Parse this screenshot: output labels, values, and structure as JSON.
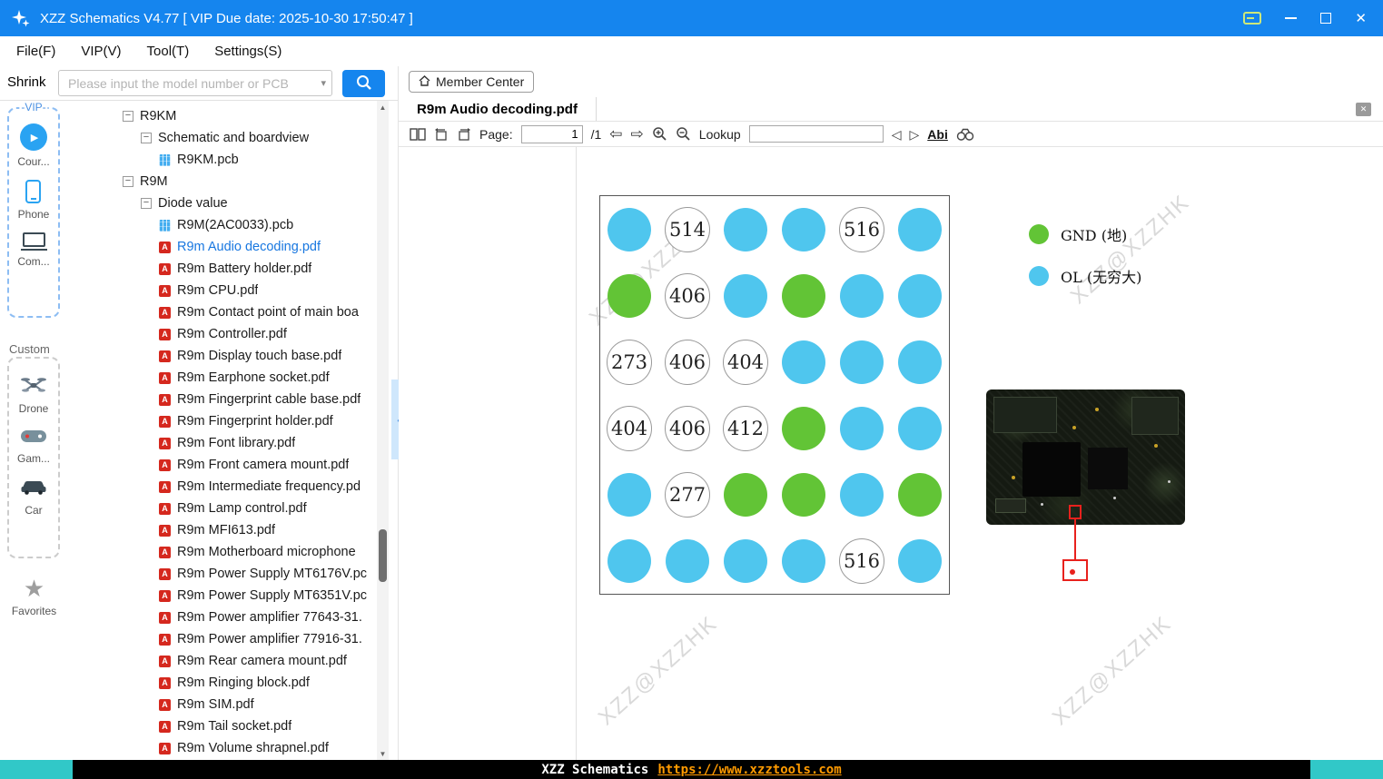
{
  "window": {
    "title": "XZZ Schematics V4.77 [ VIP Due date: 2025-10-30 17:50:47 ]"
  },
  "menubar": {
    "items": [
      "File(F)",
      "VIP(V)",
      "Tool(T)",
      "Settings(S)"
    ]
  },
  "searchbar": {
    "shrink_label": "Shrink",
    "placeholder": "Please input the model number or PCB"
  },
  "sidebar": {
    "vip_title": "-VIP-",
    "vip_items": [
      {
        "icon": "play-icon",
        "label": "Cour..."
      },
      {
        "icon": "phone-icon",
        "label": "Phone"
      },
      {
        "icon": "computer-icon",
        "label": "Com..."
      }
    ],
    "custom_title": "Custom",
    "custom_items": [
      {
        "icon": "drone-icon",
        "label": "Drone"
      },
      {
        "icon": "gamepad-icon",
        "label": "Gam..."
      },
      {
        "icon": "car-icon",
        "label": "Car"
      }
    ],
    "favorites": {
      "icon": "star-icon",
      "label": "Favorites"
    }
  },
  "tree": {
    "nodes": [
      {
        "label": "R9KM",
        "level": 0,
        "type": "folder"
      },
      {
        "label": "Schematic and boardview",
        "level": 1,
        "type": "folder"
      },
      {
        "label": "R9KM.pcb",
        "level": 2,
        "type": "pcb"
      },
      {
        "label": "R9M",
        "level": 0,
        "type": "folder"
      },
      {
        "label": "Diode value",
        "level": 1,
        "type": "folder"
      },
      {
        "label": "R9M(2AC0033).pcb",
        "level": 2,
        "type": "pcb"
      },
      {
        "label": "R9m Audio decoding.pdf",
        "level": 2,
        "type": "pdf",
        "selected": true
      },
      {
        "label": "R9m Battery holder.pdf",
        "level": 2,
        "type": "pdf"
      },
      {
        "label": "R9m CPU.pdf",
        "level": 2,
        "type": "pdf"
      },
      {
        "label": "R9m Contact point of main boa",
        "level": 2,
        "type": "pdf"
      },
      {
        "label": "R9m Controller.pdf",
        "level": 2,
        "type": "pdf"
      },
      {
        "label": "R9m Display touch base.pdf",
        "level": 2,
        "type": "pdf"
      },
      {
        "label": "R9m Earphone socket.pdf",
        "level": 2,
        "type": "pdf"
      },
      {
        "label": "R9m Fingerprint cable base.pdf",
        "level": 2,
        "type": "pdf"
      },
      {
        "label": "R9m Fingerprint holder.pdf",
        "level": 2,
        "type": "pdf"
      },
      {
        "label": "R9m Font library.pdf",
        "level": 2,
        "type": "pdf"
      },
      {
        "label": "R9m Front camera mount.pdf",
        "level": 2,
        "type": "pdf"
      },
      {
        "label": "R9m Intermediate frequency.pd",
        "level": 2,
        "type": "pdf"
      },
      {
        "label": "R9m Lamp control.pdf",
        "level": 2,
        "type": "pdf"
      },
      {
        "label": "R9m MFI613.pdf",
        "level": 2,
        "type": "pdf"
      },
      {
        "label": "R9m Motherboard microphone",
        "level": 2,
        "type": "pdf"
      },
      {
        "label": "R9m Power Supply MT6176V.pc",
        "level": 2,
        "type": "pdf"
      },
      {
        "label": "R9m Power Supply MT6351V.pc",
        "level": 2,
        "type": "pdf"
      },
      {
        "label": "R9m Power amplifier 77643-31.",
        "level": 2,
        "type": "pdf"
      },
      {
        "label": "R9m Power amplifier 77916-31.",
        "level": 2,
        "type": "pdf"
      },
      {
        "label": "R9m Rear camera mount.pdf",
        "level": 2,
        "type": "pdf"
      },
      {
        "label": "R9m Ringing block.pdf",
        "level": 2,
        "type": "pdf"
      },
      {
        "label": "R9m SIM.pdf",
        "level": 2,
        "type": "pdf"
      },
      {
        "label": "R9m Tail socket.pdf",
        "level": 2,
        "type": "pdf"
      },
      {
        "label": "R9m Volume shrapnel.pdf",
        "level": 2,
        "type": "pdf"
      }
    ]
  },
  "content": {
    "member_center": "Member Center",
    "tab_title": "R9m Audio decoding.pdf",
    "pdf_toolbar": {
      "page_label": "Page:",
      "page_value": "1",
      "page_total": "/1",
      "lookup_label": "Lookup",
      "abi_label": "Abi"
    }
  },
  "pdf": {
    "diode_grid": {
      "rows": [
        [
          {
            "t": "ol"
          },
          {
            "t": "val",
            "v": "514"
          },
          {
            "t": "ol"
          },
          {
            "t": "ol"
          },
          {
            "t": "val",
            "v": "516"
          },
          {
            "t": "ol"
          }
        ],
        [
          {
            "t": "gnd"
          },
          {
            "t": "val",
            "v": "406"
          },
          {
            "t": "ol"
          },
          {
            "t": "gnd"
          },
          {
            "t": "ol"
          },
          {
            "t": "ol"
          }
        ],
        [
          {
            "t": "val",
            "v": "273"
          },
          {
            "t": "val",
            "v": "406"
          },
          {
            "t": "val",
            "v": "404"
          },
          {
            "t": "ol"
          },
          {
            "t": "ol"
          },
          {
            "t": "ol"
          }
        ],
        [
          {
            "t": "val",
            "v": "404"
          },
          {
            "t": "val",
            "v": "406"
          },
          {
            "t": "val",
            "v": "412"
          },
          {
            "t": "gnd"
          },
          {
            "t": "ol"
          },
          {
            "t": "ol"
          }
        ],
        [
          {
            "t": "ol"
          },
          {
            "t": "val",
            "v": "277"
          },
          {
            "t": "gnd"
          },
          {
            "t": "gnd"
          },
          {
            "t": "ol"
          },
          {
            "t": "gnd"
          }
        ],
        [
          {
            "t": "ol"
          },
          {
            "t": "ol"
          },
          {
            "t": "ol"
          },
          {
            "t": "ol"
          },
          {
            "t": "val",
            "v": "516"
          },
          {
            "t": "ol"
          }
        ]
      ]
    },
    "legend": [
      {
        "type": "gnd",
        "color": "#62c436",
        "label": "GND (地)"
      },
      {
        "type": "ol",
        "color": "#4fc6ee",
        "label": "OL (无穷大)"
      }
    ],
    "watermark": "XZZ@XZZHK"
  },
  "statusbar": {
    "app_text": "XZZ Schematics",
    "url_text": "https://www.xzztools.com"
  },
  "colors": {
    "titlebar": "#1585ee",
    "accent": "#1585ee",
    "gnd_green": "#62c436",
    "ol_blue": "#4fc6ee",
    "pdf_icon_red": "#d5281e",
    "annotation_red": "#e8211d",
    "status_teal": "#31c8c8",
    "status_url_orange": "#ff9a00"
  }
}
